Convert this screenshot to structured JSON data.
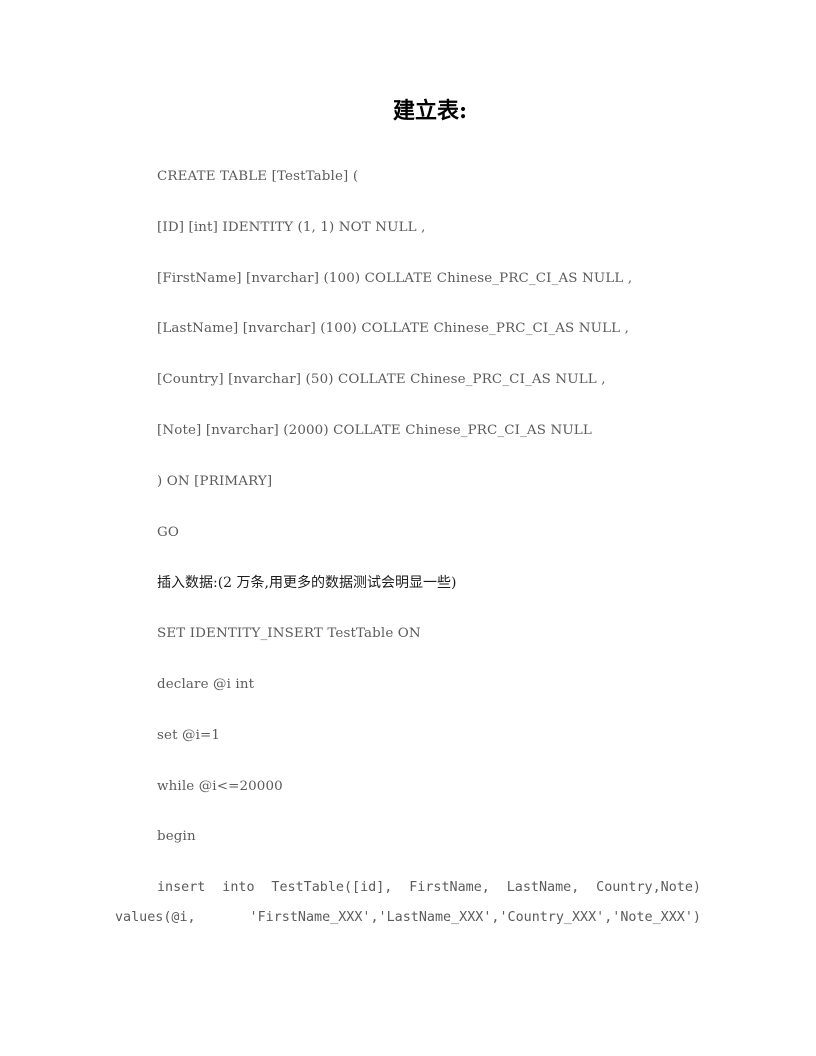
{
  "document": {
    "title": "建立表:",
    "body_text_color": "#5b5b5b",
    "title_color": "#000000",
    "background_color": "#ffffff",
    "lines": [
      {
        "id": "create-table",
        "text": "CREATE TABLE [TestTable] (",
        "style": "code"
      },
      {
        "id": "col-id",
        "text": "[ID] [int] IDENTITY (1, 1) NOT NULL ,",
        "style": "code"
      },
      {
        "id": "col-firstname",
        "text": "[FirstName] [nvarchar] (100) COLLATE Chinese_PRC_CI_AS NULL ,",
        "style": "code"
      },
      {
        "id": "col-lastname",
        "text": "[LastName] [nvarchar] (100) COLLATE Chinese_PRC_CI_AS NULL ,",
        "style": "code"
      },
      {
        "id": "col-country",
        "text": "[Country] [nvarchar] (50) COLLATE Chinese_PRC_CI_AS NULL ,",
        "style": "code"
      },
      {
        "id": "col-note",
        "text": "[Note] [nvarchar] (2000) COLLATE Chinese_PRC_CI_AS NULL",
        "style": "code"
      },
      {
        "id": "on-primary",
        "text": ") ON [PRIMARY]",
        "style": "code"
      },
      {
        "id": "go",
        "text": "GO",
        "style": "code"
      },
      {
        "id": "insert-data-note",
        "text": "插入数据:(2 万条,用更多的数据测试会明显一些)",
        "style": "cjk"
      },
      {
        "id": "set-identity-insert",
        "text": "SET IDENTITY_INSERT TestTable ON",
        "style": "code"
      },
      {
        "id": "declare-i",
        "text": "declare @i int",
        "style": "code"
      },
      {
        "id": "set-i",
        "text": "set @i=1",
        "style": "code"
      },
      {
        "id": "while-i",
        "text": "while @i<=20000",
        "style": "code"
      },
      {
        "id": "begin",
        "text": "begin",
        "style": "code"
      }
    ],
    "insert_statement": {
      "line1": "insert into TestTable([id], FirstName, LastName, Country,Note)",
      "line2": "values(@i, 'FirstName_XXX','LastName_XXX','Country_XXX','Note_XXX')"
    }
  }
}
